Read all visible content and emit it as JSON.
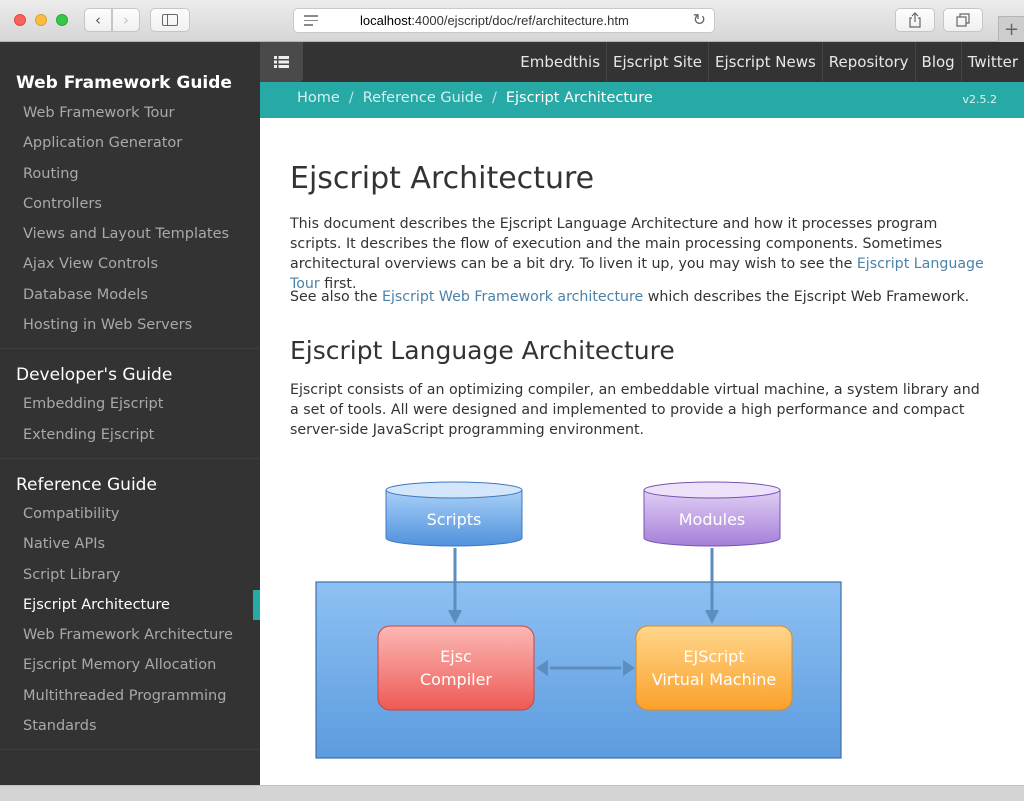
{
  "browser": {
    "url_host": "localhost",
    "url_rest": ":4000/ejscript/doc/ref/architecture.htm",
    "back_glyph": "‹",
    "forward_glyph": "›",
    "reload_glyph": "↻",
    "newtab_glyph": "+"
  },
  "sidebar": {
    "sections": [
      {
        "title": "Web Framework Guide",
        "items": [
          "Web Framework Tour",
          "Application Generator",
          "Routing",
          "Controllers",
          "Views and Layout Templates",
          "Ajax View Controls",
          "Database Models",
          "Hosting in Web Servers"
        ]
      },
      {
        "title": "Developer's Guide",
        "items": [
          "Embedding Ejscript",
          "Extending Ejscript"
        ]
      },
      {
        "title": "Reference Guide",
        "items": [
          "Compatibility",
          "Native APIs",
          "Script Library",
          "Ejscript Architecture",
          "Web Framework Architecture",
          "Ejscript Memory Allocation",
          "Multithreaded Programming",
          "Standards"
        ],
        "active_index": 3
      }
    ]
  },
  "topnav": {
    "menu_icon": "list-icon",
    "links": [
      "Embedthis",
      "Ejscript Site",
      "Ejscript News",
      "Repository",
      "Blog",
      "Twitter"
    ]
  },
  "breadcrumb": {
    "home": "Home",
    "parent": "Reference Guide",
    "current": "Ejscript Architecture",
    "separator": "/",
    "version": "v2.5.2"
  },
  "content": {
    "title": "Ejscript Architecture",
    "p1_before": "This document describes the Ejscript Language Architecture and how it processes program scripts. It describes the flow of execution and the main processing components. Sometimes architectural overviews can be a bit dry. To liven it up, you may wish to see the ",
    "p1_link": "Ejscript Language Tour",
    "p1_after": " first.",
    "p2_before": "See also the ",
    "p2_link": "Ejscript Web Framework architecture",
    "p2_after": " which describes the Ejscript Web Framework.",
    "h2": "Ejscript Language Architecture",
    "p3": "Ejscript consists of an optimizing compiler, an embeddable virtual machine, a system library and a set of tools. All were designed and implemented to provide a high performance and compact server-side JavaScript programming environment."
  },
  "diagram": {
    "scripts_label": "Scripts",
    "modules_label": "Modules",
    "compiler_line1": "Ejsc",
    "compiler_line2": "Compiler",
    "vm_line1": "EJScript",
    "vm_line2": "Virtual Machine"
  },
  "colors": {
    "accent": "#27a9a5",
    "nav_bg": "#333333",
    "link": "#4b82a9"
  }
}
